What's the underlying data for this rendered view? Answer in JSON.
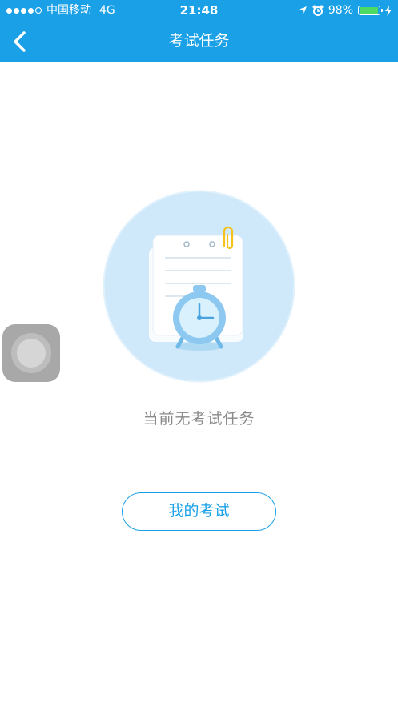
{
  "status_bar": {
    "carrier": "中国移动",
    "network": "4G",
    "time": "21:48",
    "battery_percent": "98%",
    "battery_level": 0.98
  },
  "nav": {
    "title": "考试任务",
    "back_icon": "chevron-left-icon"
  },
  "empty_state": {
    "illustration": "clipboard-alarm-clock-illustration",
    "message": "当前无考试任务"
  },
  "actions": {
    "my_exam_label": "我的考试"
  },
  "colors": {
    "accent": "#1aa0e6",
    "illustration_bg": "#cfe9fb",
    "battery": "#4cd964"
  }
}
